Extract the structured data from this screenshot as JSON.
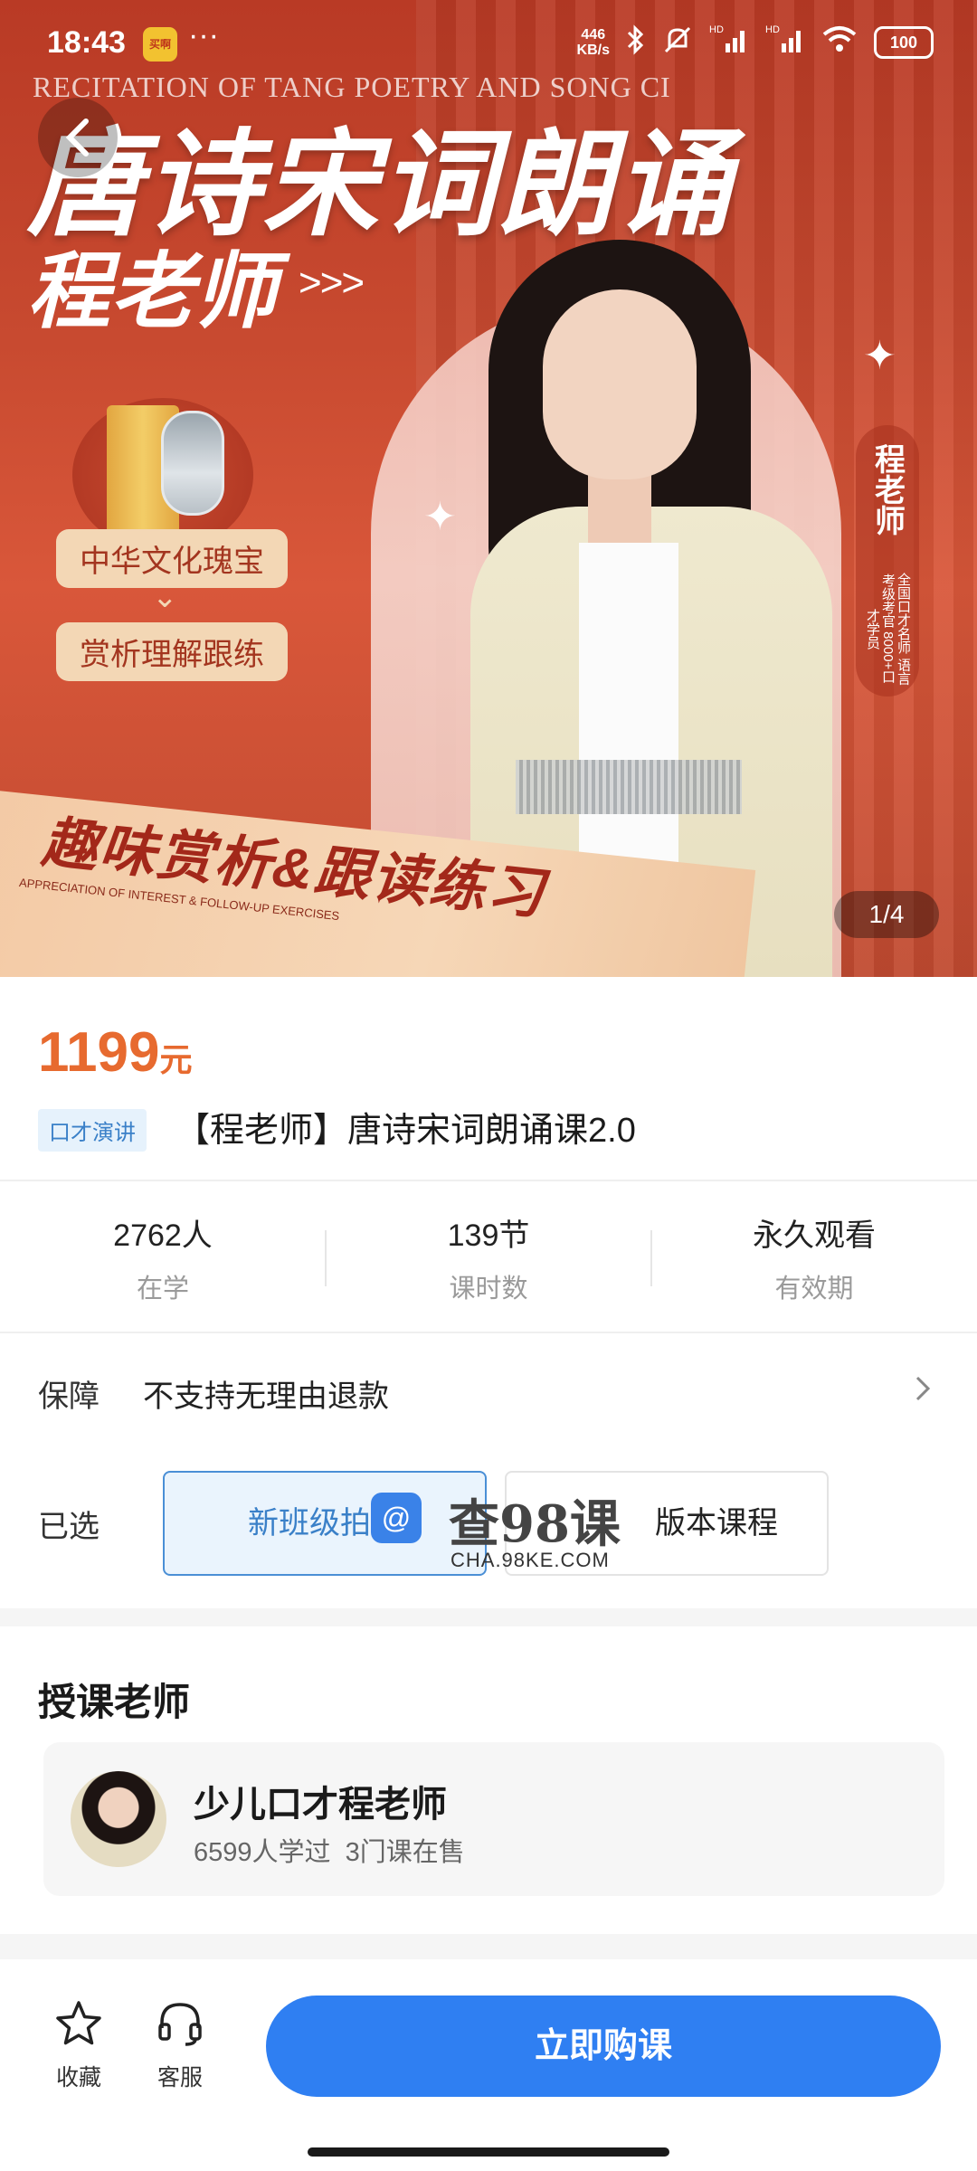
{
  "status": {
    "time": "18:43",
    "app_icon_text": "买啊",
    "dots": "···",
    "net_speed_value": "446",
    "net_speed_unit": "KB/s",
    "hd1": "HD",
    "hd2": "HD",
    "battery": "100"
  },
  "hero": {
    "english_subtitle": "RECITATION OF TANG POETRY AND SONG CI",
    "title": "唐诗宋词朗诵",
    "teacher": "程老师",
    "arrows": ">>>",
    "pill_1": "中华文化瑰宝",
    "pill_2": "赏析理解跟练",
    "side_name": "程老师",
    "side_desc": "全国口才名师 语言考级考官 8000+口才学员",
    "band_text": "趣味赏析&跟读练习",
    "band_en": "APPRECIATION OF INTEREST & FOLLOW-UP EXERCISES",
    "page_indicator": "1/4",
    "colors": {
      "primary": "#c84a30",
      "accent": "#f3d7b5"
    }
  },
  "product": {
    "price": "1199",
    "price_unit": "元",
    "category_tag": "口才演讲",
    "title": "【程老师】唐诗宋词朗诵课2.0",
    "price_color": "#e76a2f"
  },
  "stats": [
    {
      "value": "2762人",
      "label": "在学"
    },
    {
      "value": "139节",
      "label": "课时数"
    },
    {
      "value": "永久观看",
      "label": "有效期"
    }
  ],
  "guarantee": {
    "label": "保障",
    "text": "不支持无理由退款"
  },
  "selection": {
    "label": "已选",
    "options": [
      "新班级拍这",
      "版本课程"
    ],
    "selected_index": 0
  },
  "watermark": {
    "text": "查98课",
    "url": "CHA.98KE.COM"
  },
  "teacher_section": {
    "heading": "授课老师",
    "name": "少儿口才程老师",
    "learners": "6599人学过",
    "courses": "3门课在售"
  },
  "bottom_bar": {
    "favorite_label": "收藏",
    "service_label": "客服",
    "buy_label": "立即购课",
    "buy_color": "#2f7ff2"
  }
}
